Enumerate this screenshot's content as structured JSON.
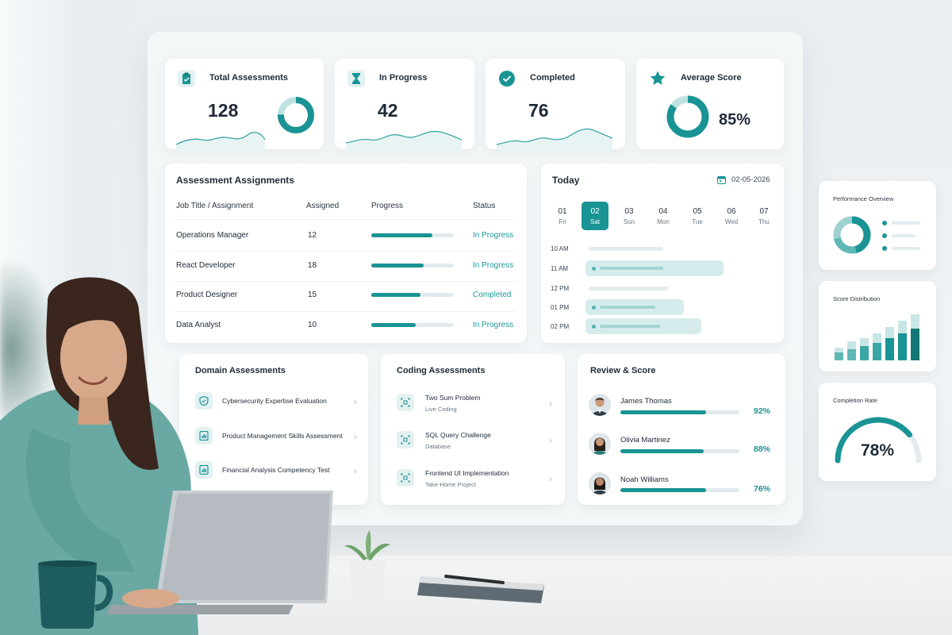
{
  "stats": [
    {
      "title": "Total Assessments",
      "value": "128",
      "icon": "clipboard-check-icon"
    },
    {
      "title": "In Progress",
      "value": "42",
      "icon": "hourglass-icon"
    },
    {
      "title": "Completed",
      "value": "76",
      "icon": "check-circle-icon"
    },
    {
      "title": "Average Score",
      "value": "85%",
      "icon": "star-icon",
      "ring_fraction": 0.85
    }
  ],
  "assignments": {
    "title": "Assessment Assignments",
    "columns": [
      "Job Title / Assignment",
      "Assigned",
      "Progress",
      "Status"
    ],
    "rows": [
      {
        "job": "Operations Manager",
        "assigned": "12",
        "progress": 0.74,
        "status": "In Progress"
      },
      {
        "job": "React Developer",
        "assigned": "18",
        "progress": 0.63,
        "status": "In Progress"
      },
      {
        "job": "Product Designer",
        "assigned": "15",
        "progress": 0.6,
        "status": "Completed"
      },
      {
        "job": "Data Analyst",
        "assigned": "10",
        "progress": 0.54,
        "status": "In Progress"
      }
    ]
  },
  "calendar": {
    "title": "Today",
    "date": "02-05-2026",
    "days": [
      {
        "num": "01",
        "name": "Fri",
        "active": false
      },
      {
        "num": "02",
        "name": "Sat",
        "active": true
      },
      {
        "num": "03",
        "name": "Sun",
        "active": false
      },
      {
        "num": "04",
        "name": "Mon",
        "active": false
      },
      {
        "num": "05",
        "name": "Tue",
        "active": false
      },
      {
        "num": "06",
        "name": "Wed",
        "active": false
      },
      {
        "num": "07",
        "name": "Thu",
        "active": false
      }
    ],
    "times": [
      "10 AM",
      "11 AM",
      "12 PM",
      "01 PM",
      "02 PM"
    ]
  },
  "domain": {
    "title": "Domain Assessments",
    "items": [
      {
        "title": "Cybersecurity Expertise Evaluation",
        "icon": "shield-icon"
      },
      {
        "title": "Product Management Skills Assessment",
        "icon": "chart-doc-icon"
      },
      {
        "title": "Financial Analysis Competency Test",
        "icon": "chart-doc-icon"
      }
    ]
  },
  "coding": {
    "title": "Coding Assessments",
    "items": [
      {
        "title": "Two Sum Problem",
        "sub": "Live Coding",
        "icon": "code-icon"
      },
      {
        "title": "SQL Query Challenge",
        "sub": "Database",
        "icon": "code-icon"
      },
      {
        "title": "Frontend UI Implementation",
        "sub": "Take-Home Project",
        "icon": "code-icon"
      }
    ]
  },
  "review": {
    "title": "Review & Score",
    "items": [
      {
        "name": "James Thomas",
        "pct": "92%",
        "fraction": 0.72
      },
      {
        "name": "Olivia Martinez",
        "pct": "88%",
        "fraction": 0.7
      },
      {
        "name": "Noah Williams",
        "pct": "76%",
        "fraction": 0.72
      }
    ]
  },
  "side": {
    "performance": {
      "title": "Performance Overview"
    },
    "distribution": {
      "title": "Score Distribution"
    },
    "completion": {
      "title": "Completion Rate",
      "value": "78%",
      "fraction": 0.78
    }
  },
  "colors": {
    "accent": "#1a9394",
    "accent_light": "#d6ecec",
    "status": "#1a9a98"
  }
}
